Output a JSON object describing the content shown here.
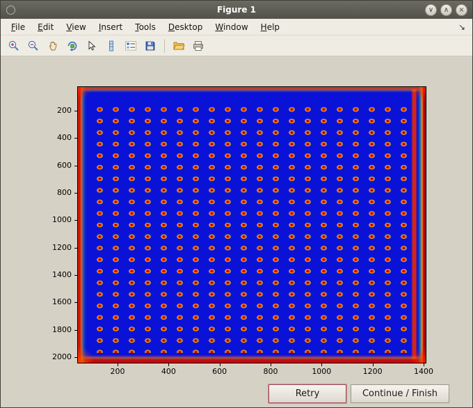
{
  "window": {
    "title": "Figure 1",
    "controls": {
      "minimize": "∨",
      "maximize": "∧",
      "close": "×"
    }
  },
  "menubar": {
    "items": [
      "File",
      "Edit",
      "View",
      "Insert",
      "Tools",
      "Desktop",
      "Window",
      "Help"
    ],
    "dock_icon": "↘"
  },
  "toolbar": {
    "icons": [
      "zoom-in",
      "zoom-out",
      "pan",
      "rotate-3d",
      "data-cursor",
      "colorbar",
      "insert-legend",
      "save",
      "open-folder",
      "print"
    ]
  },
  "plot": {
    "type": "image",
    "description": "Microarray plate scan shown with jet colormap: regular grid of red/orange spots on deep blue background with bright red/orange edges and corners, plus a red vertical band near the right edge",
    "y_ticks": [
      "200",
      "400",
      "600",
      "800",
      "1000",
      "1200",
      "1400",
      "1600",
      "1800",
      "2000"
    ],
    "x_ticks": [
      "200",
      "400",
      "600",
      "800",
      "1000",
      "1200",
      "1400"
    ]
  },
  "buttons": {
    "retry": "Retry",
    "continue_finish": "Continue / Finish"
  },
  "colors": {
    "titlebar": "#5b5b52",
    "chrome": "#efece3",
    "figure_bg": "#d5d1c5",
    "plate_blue": "#0b12d8",
    "spot_red": "#e83800",
    "retry_border": "#a34b5e"
  }
}
